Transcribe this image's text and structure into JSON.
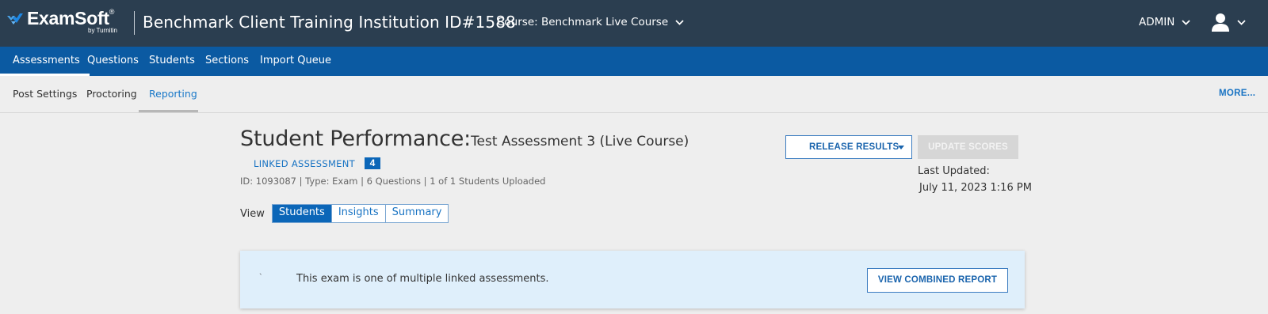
{
  "header": {
    "logo_text": "ExamSoft",
    "logo_registered": "®",
    "logo_sub": "by Turnitin",
    "institution": "Benchmark Client Training Institution ID#1588",
    "course_label": "Course: Benchmark Live Course",
    "admin_label": "ADMIN"
  },
  "nav": {
    "items": [
      {
        "label": "Assessments"
      },
      {
        "label": "Questions"
      },
      {
        "label": "Students"
      },
      {
        "label": "Sections"
      },
      {
        "label": "Import Queue"
      }
    ],
    "active": "Assessments"
  },
  "subnav": {
    "items": [
      {
        "label": "Post Settings"
      },
      {
        "label": "Proctoring"
      },
      {
        "label": "Reporting"
      }
    ],
    "active": "Reporting",
    "more_label": "MORE..."
  },
  "main": {
    "title": "Student Performance:",
    "subtitle": "Test Assessment 3 (Live Course)",
    "linked_label": "LINKED ASSESSMENT",
    "linked_count": "4",
    "meta": "ID: 1093087 | Type: Exam | 6 Questions | 1 of 1 Students Uploaded",
    "view_label": "View",
    "view_options": [
      "Students",
      "Insights",
      "Summary"
    ],
    "view_selected": "Students",
    "release_label": "RELEASE RESULTS",
    "update_label": "UPDATE SCORES",
    "last_updated_label": "Last Updated:",
    "last_updated_value": "July 11, 2023 1:16 PM"
  },
  "notice": {
    "tick": "`",
    "text": "This exam is one of multiple linked assessments.",
    "button_label": "VIEW COMBINED REPORT"
  },
  "colors": {
    "header_bg": "#2b3e50",
    "nav_bg": "#0b5aa2",
    "accent": "#1873c3",
    "notice_bg": "#dfeffb"
  }
}
